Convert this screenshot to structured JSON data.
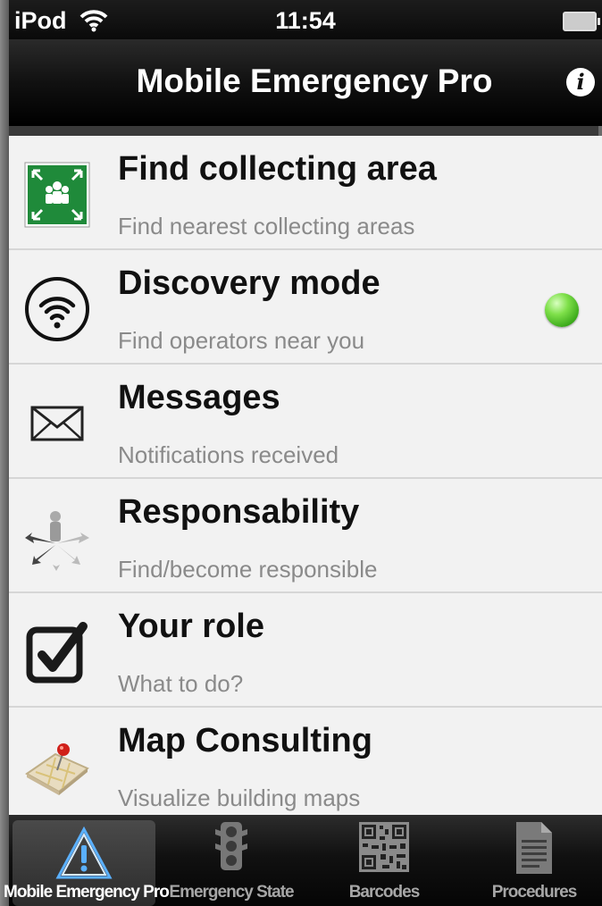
{
  "status_bar": {
    "carrier": "iPod",
    "time": "11:54"
  },
  "nav": {
    "title": "Mobile Emergency Pro",
    "info_icon": "info-icon"
  },
  "rows": [
    {
      "title": "Find collecting area",
      "subtitle": "Find nearest collecting areas",
      "icon": "assembly-point-icon"
    },
    {
      "title": "Discovery mode",
      "subtitle": "Find operators near you",
      "icon": "wifi-circle-icon",
      "status": "on",
      "status_color": "#5cc431"
    },
    {
      "title": "Messages",
      "subtitle": "Notifications received",
      "icon": "envelope-icon"
    },
    {
      "title": "Responsability",
      "subtitle": "Find/become responsible",
      "icon": "people-arrows-icon"
    },
    {
      "title": "Your role",
      "subtitle": "What to do?",
      "icon": "checkbox-icon"
    },
    {
      "title": "Map Consulting",
      "subtitle": "Visualize building maps",
      "icon": "map-pin-icon"
    }
  ],
  "tabs": [
    {
      "label": "Mobile Emergency Pro",
      "icon": "warning-icon",
      "active": true
    },
    {
      "label": "Emergency State",
      "icon": "traffic-light-icon",
      "active": false
    },
    {
      "label": "Barcodes",
      "icon": "qr-code-icon",
      "active": false
    },
    {
      "label": "Procedures",
      "icon": "document-icon",
      "active": false
    }
  ],
  "colors": {
    "accent_green": "#1f8a3a",
    "status_led": "#5cc431",
    "background": "#f2f2f2"
  }
}
